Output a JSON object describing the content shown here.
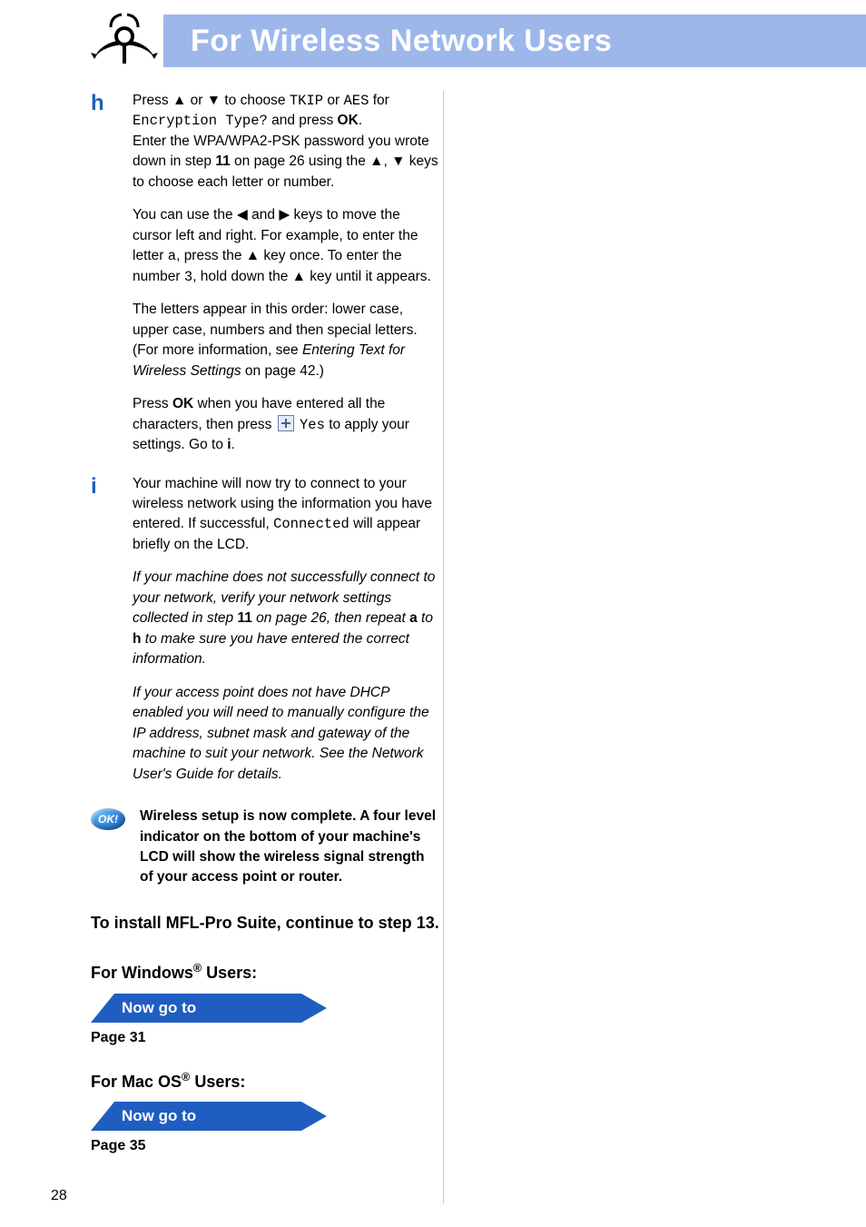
{
  "header": {
    "title": "For Wireless Network Users"
  },
  "sym": {
    "up": "▲",
    "down": "▼",
    "left": "◀",
    "right": "▶"
  },
  "steps": {
    "h": {
      "letter": "h",
      "p1a": "Press ",
      "p1b": " or ",
      "p1c": " to choose ",
      "tkip": "TKIP",
      "p1d": " or ",
      "aes": "AES",
      "p1e": " for ",
      "enc_type": "Encryption Type?",
      "p1f": " and press ",
      "ok": "OK",
      "p1g": ".",
      "p2a": "Enter the WPA/WPA2-PSK password you wrote down in step ",
      "step11": "11",
      "p2b": " on page 26 using the ",
      "p2c": ", ",
      "p2d": " keys to choose each letter or number.",
      "p3a": "You can use the ",
      "p3b": " and ",
      "p3c": " keys to move the cursor left and right. For example, to enter the letter ",
      "letter_a": "a",
      "p3d": ", press the ",
      "p3e": " key once. To enter the number ",
      "num3": "3",
      "p3f": ", hold down the ",
      "p3g": " key until it appears.",
      "p4a": "The letters appear in this order: lower case, upper case, numbers and then special letters. (For more information, see ",
      "p4i": "Entering Text for Wireless Settings",
      "p4b": " on page 42.)",
      "p5a": "Press ",
      "p5b": " when you have entered all the characters, then press ",
      "yes": "Yes",
      "p5c": " to apply your settings. Go to ",
      "goto_i": "i",
      "p5d": "."
    },
    "i": {
      "letter": "i",
      "p1a": "Your machine will now try to connect to your wireless network using the information you have entered. If successful, ",
      "connected": "Connected",
      "p1b": " will appear briefly on the LCD.",
      "p2a": "If your machine does not successfully connect to your network, verify your network settings collected in step ",
      "step11": "11",
      "p2b": " on page 26, then repeat ",
      "ref_a": "a",
      "p2c": " to ",
      "ref_h": "h",
      "p2d": " to make sure you have entered the correct information.",
      "p3": "If your access point does not have DHCP enabled you will need to manually configure the IP address, subnet mask and gateway of the machine to suit your network. See the Network User's Guide for details."
    }
  },
  "ok_badge": {
    "label": "OK!"
  },
  "ok_text": "Wireless setup is now complete. A four level indicator on the bottom of your machine's LCD will show the wireless signal strength of your access point or router.",
  "install": {
    "line1a": "To install MFL-Pro Suite, continue to step",
    "step13": "13",
    "line1b": "."
  },
  "windows": {
    "heading_a": "For Windows",
    "heading_b": " Users:",
    "goto": "Now go to",
    "page": "Page 31"
  },
  "mac": {
    "heading_a": "For Mac OS",
    "heading_b": " Users:",
    "goto": "Now go to",
    "page": "Page 35"
  },
  "page_number": "28"
}
